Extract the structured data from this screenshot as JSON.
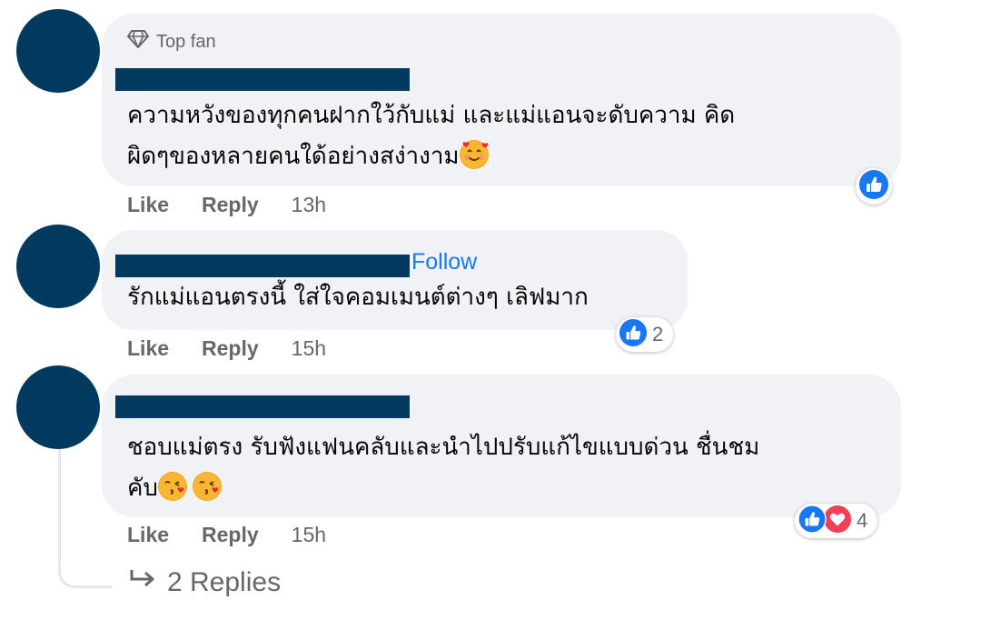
{
  "comments": [
    {
      "badge": "Top fan",
      "text_line1": "ความหวังของทุกคนฝากใว้กับแม่ และแม่แอนจะดับความ คิด",
      "text_line2": "ผิดๆของหลายคนใด้อย่างสง่างาม",
      "like": "Like",
      "reply": "Reply",
      "time": "13h",
      "reaction_count": ""
    },
    {
      "follow": "Follow",
      "text_line1": "รักแม่แอนตรงนี้ ใส่ใจคอมเมนต์ต่างๆ เลิฟมาก",
      "like": "Like",
      "reply": "Reply",
      "time": "15h",
      "reaction_count": "2"
    },
    {
      "text_line1": "ชอบแม่ตรง รับฟังแฟนคลับและนำไปปรับแก้ไขแบบด่วน ชื่นชม",
      "text_line2": "คับ",
      "like": "Like",
      "reply": "Reply",
      "time": "15h",
      "reaction_count": "4"
    }
  ],
  "replies_link": "2 Replies",
  "colors": {
    "avatar": "#003a5f",
    "bubble": "#f0f2f5",
    "like_blue": "#1877f2",
    "love_red": "#f33e58",
    "meta_gray": "#65676b"
  }
}
